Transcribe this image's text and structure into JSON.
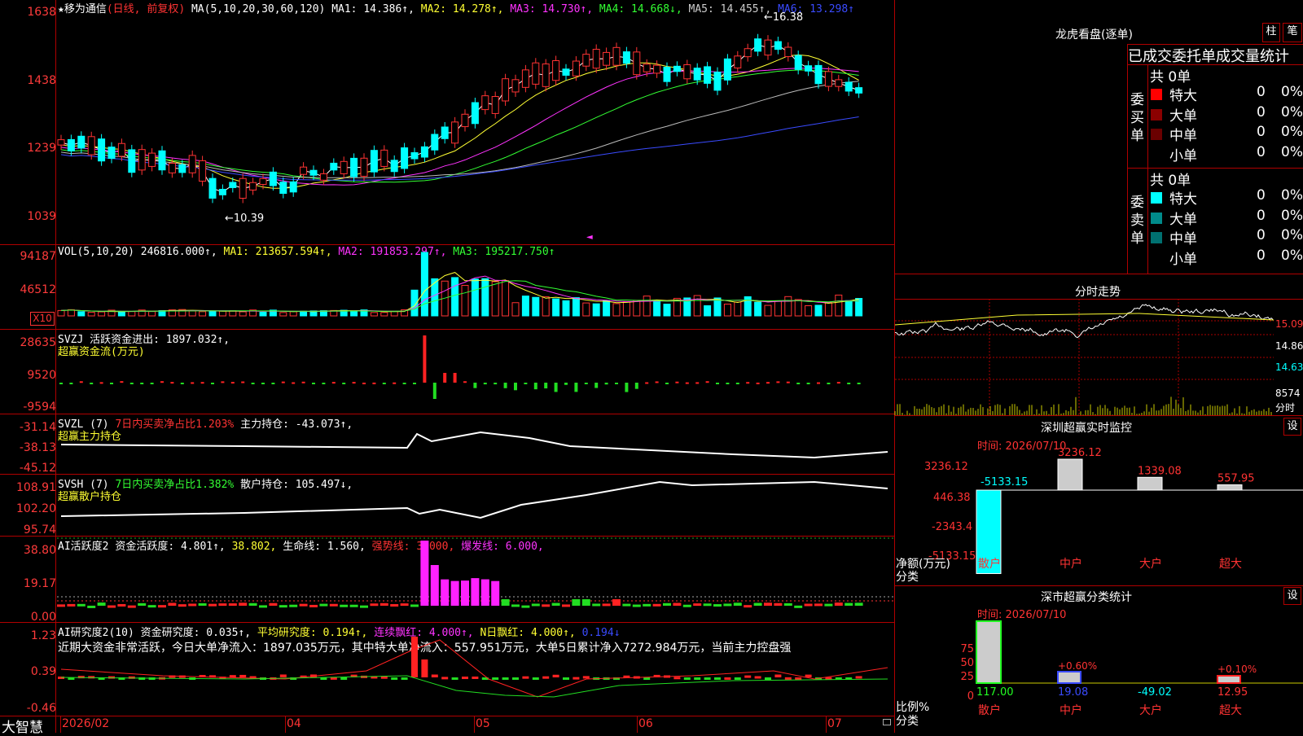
{
  "stock": {
    "star": "★",
    "name": "移为通信",
    "mode": "(日线, 前复权)"
  },
  "price_pane": {
    "ma_label": "MA(5,10,20,30,60,120)",
    "ma": [
      {
        "label": "MA1: 14.386↑,",
        "color": "#ffffff"
      },
      {
        "label": "MA2: 14.278↑,",
        "color": "#ffff33"
      },
      {
        "label": "MA3: 14.730↑,",
        "color": "#ff33ff"
      },
      {
        "label": "MA4: 14.668↓,",
        "color": "#33ff33"
      },
      {
        "label": "MA5: 14.455↑,",
        "color": "#cccccc"
      },
      {
        "label": "MA6: 13.298↑",
        "color": "#3a4bff"
      }
    ],
    "y_ticks": [
      "1638",
      "1438",
      "1239",
      "1039"
    ],
    "high_label": "16.38",
    "low_label": "10.39"
  },
  "vol_pane": {
    "label": "VOL(5,10,20)",
    "value": "246816.000↑,",
    "ma1": "MA1: 213657.594↑,",
    "ma2": "MA2: 191853.297↑,",
    "ma3": "MA3: 195217.750↑",
    "y_ticks": [
      "94187",
      "46512"
    ],
    "unit": "X10"
  },
  "svzj_pane": {
    "label": "SVZJ",
    "value": "活跃资金进出: 1897.032↑,",
    "subtitle": "超赢资金流(万元)",
    "y_ticks": [
      "28635",
      "9520",
      "-9594"
    ]
  },
  "svzl_pane": {
    "label": "SVZL (7)",
    "ratio": "7日内买卖净占比1.203%",
    "value": "主力持仓: -43.073↑,",
    "subtitle": "超赢主力持仓",
    "y_ticks": [
      "-31.14",
      "-38.13",
      "-45.12"
    ]
  },
  "svsh_pane": {
    "label": "SVSH (7)",
    "ratio": "7日内买卖净占比1.382%",
    "value": "散户持仓: 105.497↓,",
    "subtitle": "超赢散户持仓",
    "y_ticks": [
      "108.91",
      "102.20",
      "95.74"
    ]
  },
  "ai_active_pane": {
    "label": "AI活跃度2",
    "v1": "资金活跃度: 4.801↑,",
    "v2": "38.802,",
    "v3": "生命线: 1.560,",
    "v4": "强势线: 3.000,",
    "v5": "爆发线: 6.000,",
    "y_ticks": [
      "38.80",
      "19.17",
      "0.00"
    ]
  },
  "ai_research_pane": {
    "label": "AI研究度2(10)",
    "v1": "资金研究度: 0.035↑,",
    "v2": "平均研究度: 0.194↑,",
    "v3": "连续飘红: 4.000↑,",
    "v4": "N日飘红: 4.000↑,",
    "v5": "0.194↓",
    "comment": "近期大资金非常活跃，今日大单净流入：1897.035万元，其中特大单净流入：557.951万元，大单5日累计净入7272.984万元，当前主力控盘强",
    "y_ticks": [
      "1.23",
      "0.39",
      "-0.46"
    ]
  },
  "x_axis": {
    "brand": "大智慧",
    "labels": [
      "2026/02",
      "04",
      "05",
      "06",
      "07"
    ]
  },
  "dragon_tiger": {
    "title": "龙虎看盘(逐单)",
    "btn_bar": "柱",
    "btn_pen": "笔",
    "header": "已成交委托单成交量统计",
    "buy_side": "委买单",
    "sell_side": "委卖单",
    "buy_total": "共 0单",
    "sell_total": "共 0单",
    "buy_rows": [
      {
        "label": "特大",
        "count": "0",
        "pct": "0%",
        "color": "#ff0000"
      },
      {
        "label": "大单",
        "count": "0",
        "pct": "0%",
        "color": "#8b0000"
      },
      {
        "label": "中单",
        "count": "0",
        "pct": "0%",
        "color": "#6a0000"
      },
      {
        "label": "小单",
        "count": "0",
        "pct": "0%",
        "color": "#000000"
      }
    ],
    "sell_rows": [
      {
        "label": "特大",
        "count": "0",
        "pct": "0%",
        "color": "#00ffff"
      },
      {
        "label": "大单",
        "count": "0",
        "pct": "0%",
        "color": "#008b8b"
      },
      {
        "label": "中单",
        "count": "0",
        "pct": "0%",
        "color": "#007070"
      },
      {
        "label": "小单",
        "count": "0",
        "pct": "0%",
        "color": "#000000"
      }
    ]
  },
  "intraday": {
    "title": "分时走势",
    "right_ticks": [
      "15.09",
      "14.86",
      "14.63",
      "8574"
    ],
    "unit": "分时"
  },
  "monitor": {
    "title": "深圳超赢实时监控",
    "setting": "设",
    "time": "时间: 2026/07/10",
    "y_ticks": [
      "3236.12",
      "446.38",
      "-2343.4",
      "-5133.15"
    ],
    "y_label": "净额(万元)",
    "x_label": "分类",
    "categories": [
      "散户",
      "中户",
      "大户",
      "超大"
    ],
    "values": [
      -5133.15,
      3236.12,
      1339.08,
      557.95
    ],
    "value_labels": [
      "-5133.15",
      "3236.12",
      "1339.08",
      "557.95"
    ]
  },
  "classify": {
    "title": "深市超赢分类统计",
    "setting": "设",
    "time": "时间: 2026/07/10",
    "y_ticks": [
      "75",
      "50",
      "25",
      "0"
    ],
    "y_label": "比例%",
    "x_label": "分类",
    "categories": [
      "散户",
      "中户",
      "大户",
      "超大"
    ],
    "pct_labels": [
      "",
      "+0.60%",
      "",
      "+0.10%"
    ],
    "values": [
      "117.00",
      "19.08",
      "-49.02",
      "12.95"
    ]
  }
}
